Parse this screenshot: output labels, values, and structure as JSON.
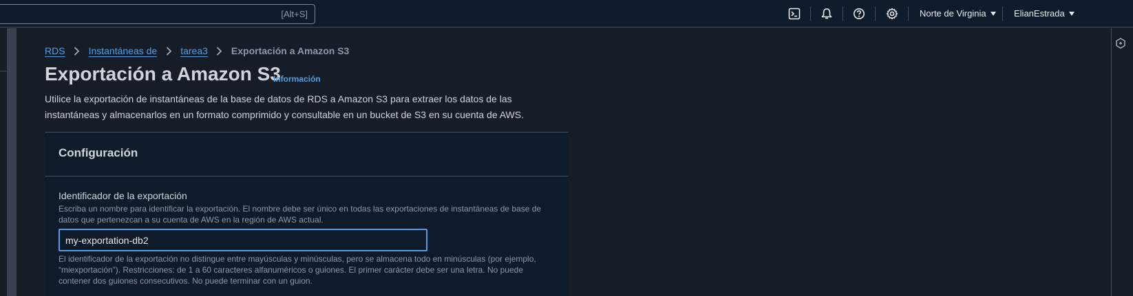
{
  "topbar": {
    "search_shortcut": "[Alt+S]",
    "icons": [
      "cloudshell-icon",
      "bell-icon",
      "help-icon",
      "settings-icon"
    ],
    "region": "Norte de Virginia",
    "user": "ElianEstrada"
  },
  "breadcrumb": {
    "items": [
      "RDS",
      "Instantáneas de",
      "tarea3"
    ],
    "current": "Exportación a Amazon S3"
  },
  "header": {
    "title": "Exportación a Amazon S3",
    "info": "Información",
    "description": "Utilice la exportación de instantáneas de la base de datos de RDS a Amazon S3 para extraer los datos de las instantáneas y almacenarlos en un formato comprimido y consultable en un bucket de S3 en su cuenta de AWS."
  },
  "configuration": {
    "title": "Configuración",
    "export_id": {
      "label": "Identificador de la exportación",
      "description": "Escriba un nombre para identificar la exportación. El nombre debe ser único en todas las exportaciones de instantáneas de base de datos que pertenezcan a su cuenta de AWS en la región de AWS actual.",
      "value": "my-exportation-db2",
      "constraint": "El identificador de la exportación no distingue entre mayúsculas y minúsculas, pero se almacena todo en minúsculas (por ejemplo, “miexportación”). Restricciones: de 1 a 60 caracteres alfanuméricos o guiones. El primer carácter debe ser una letra. No puede contener dos guiones consecutivos. No puede terminar con un guion."
    }
  },
  "colors": {
    "link": "#539fe5",
    "background": "#0f1b2a",
    "panel": "#161d26",
    "border": "#414d5c"
  }
}
